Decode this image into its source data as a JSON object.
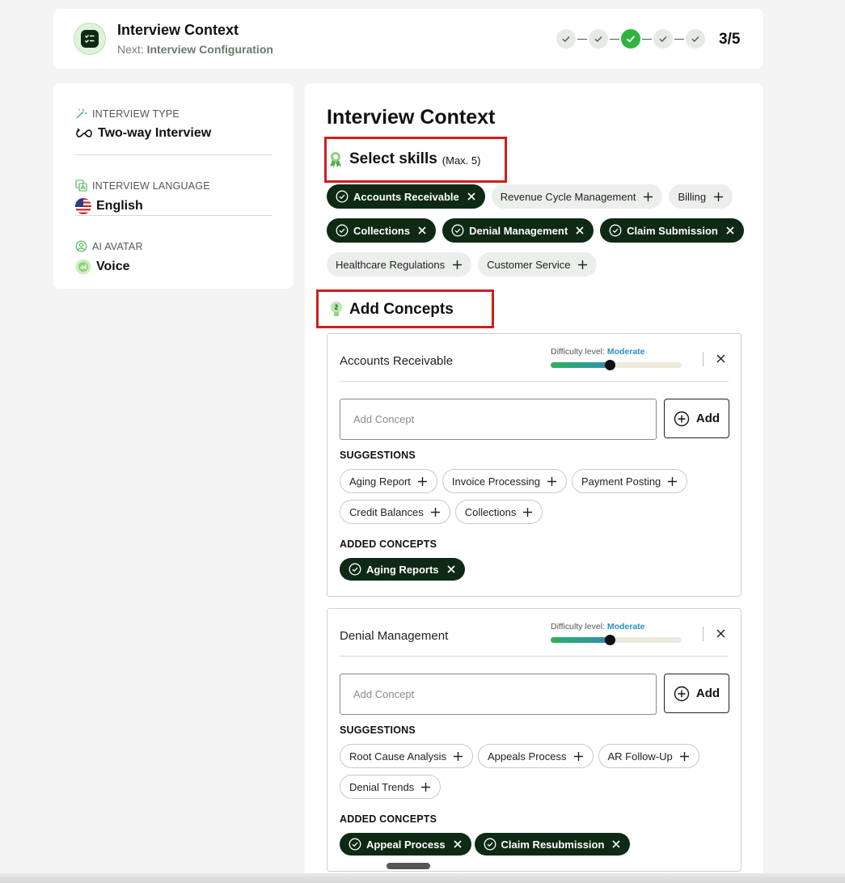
{
  "header": {
    "title": "Interview Context",
    "next_prefix": "Next:",
    "next_value": "Interview Configuration",
    "step_count": "3/5",
    "steps": [
      {
        "state": "done"
      },
      {
        "state": "done"
      },
      {
        "state": "current"
      },
      {
        "state": "done"
      },
      {
        "state": "done"
      }
    ]
  },
  "sidebar": {
    "sections": [
      {
        "label": "INTERVIEW TYPE",
        "value": "Two-way Interview",
        "label_icon": "magic-wand-icon",
        "value_icon": "two-way-icon"
      },
      {
        "label": "INTERVIEW LANGUAGE",
        "value": "English",
        "label_icon": "translate-icon",
        "value_icon": "us-flag-icon"
      },
      {
        "label": "AI AVATAR",
        "value": "Voice",
        "label_icon": "avatar-icon",
        "value_icon": "voice-avatar-icon"
      }
    ]
  },
  "main": {
    "title": "Interview Context",
    "skills": {
      "heading": "Select skills",
      "max_note": "(Max. 5)",
      "rows": [
        [
          {
            "label": "Accounts Receivable",
            "selected": true
          },
          {
            "label": "Revenue Cycle Management",
            "selected": false
          },
          {
            "label": "Billing",
            "selected": false
          }
        ],
        [
          {
            "label": "Collections",
            "selected": true
          },
          {
            "label": "Denial Management",
            "selected": true
          },
          {
            "label": "Claim Submission",
            "selected": true
          }
        ],
        [
          {
            "label": "Healthcare Regulations",
            "selected": false
          },
          {
            "label": "Customer Service",
            "selected": false
          }
        ]
      ]
    },
    "concepts_heading": "Add Concepts",
    "concept_cards": [
      {
        "title": "Accounts Receivable",
        "difficulty_label": "Difficulty level:",
        "difficulty_value": "Moderate",
        "difficulty_level": 0.45,
        "input_placeholder": "Add Concept",
        "add_label": "Add",
        "suggestions_label": "SUGGESTIONS",
        "suggestion_rows": [
          [
            "Aging Report",
            "Invoice Processing",
            "Payment Posting"
          ],
          [
            "Credit Balances",
            "Collections"
          ]
        ],
        "added_label": "ADDED CONCEPTS",
        "added": [
          "Aging Reports"
        ]
      },
      {
        "title": "Denial Management",
        "difficulty_label": "Difficulty level:",
        "difficulty_value": "Moderate",
        "difficulty_level": 0.45,
        "input_placeholder": "Add Concept",
        "add_label": "Add",
        "suggestions_label": "SUGGESTIONS",
        "suggestion_rows": [
          [
            "Root Cause Analysis",
            "Appeals Process",
            "AR Follow-Up"
          ],
          [
            "Denial Trends"
          ]
        ],
        "added_label": "ADDED CONCEPTS",
        "added": [
          "Appeal Process",
          "Claim Resubmission"
        ]
      }
    ]
  },
  "colors": {
    "selected_chip": "#0e2a14",
    "current_step": "#31b342",
    "highlight_box": "#cc1f1f",
    "difficulty_value": "#2a8fc4"
  }
}
